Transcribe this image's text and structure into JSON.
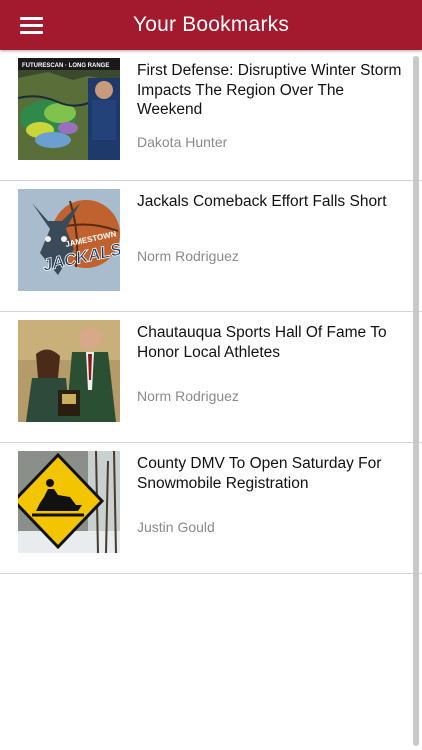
{
  "header": {
    "title": "Your Bookmarks",
    "menu_icon": "hamburger-menu-icon",
    "background_color": "#a3192d"
  },
  "bookmarks": [
    {
      "headline": "First Defense: Disruptive Winter Storm Impacts The Region Over The Weekend",
      "author": "Dakota Hunter",
      "thumbnail_caption": "FUTURESCAN · LONG RANGE"
    },
    {
      "headline": "Jackals Comeback Effort Falls Short",
      "author": "Norm Rodriguez",
      "thumbnail_caption_top": "JAMESTOWN",
      "thumbnail_caption_main": "JACKALS"
    },
    {
      "headline": "Chautauqua Sports Hall Of Fame To Honor Local Athletes",
      "author": "Norm Rodriguez"
    },
    {
      "headline": "County DMV To Open Saturday For Snowmobile Registration",
      "author": "Justin Gould"
    }
  ]
}
